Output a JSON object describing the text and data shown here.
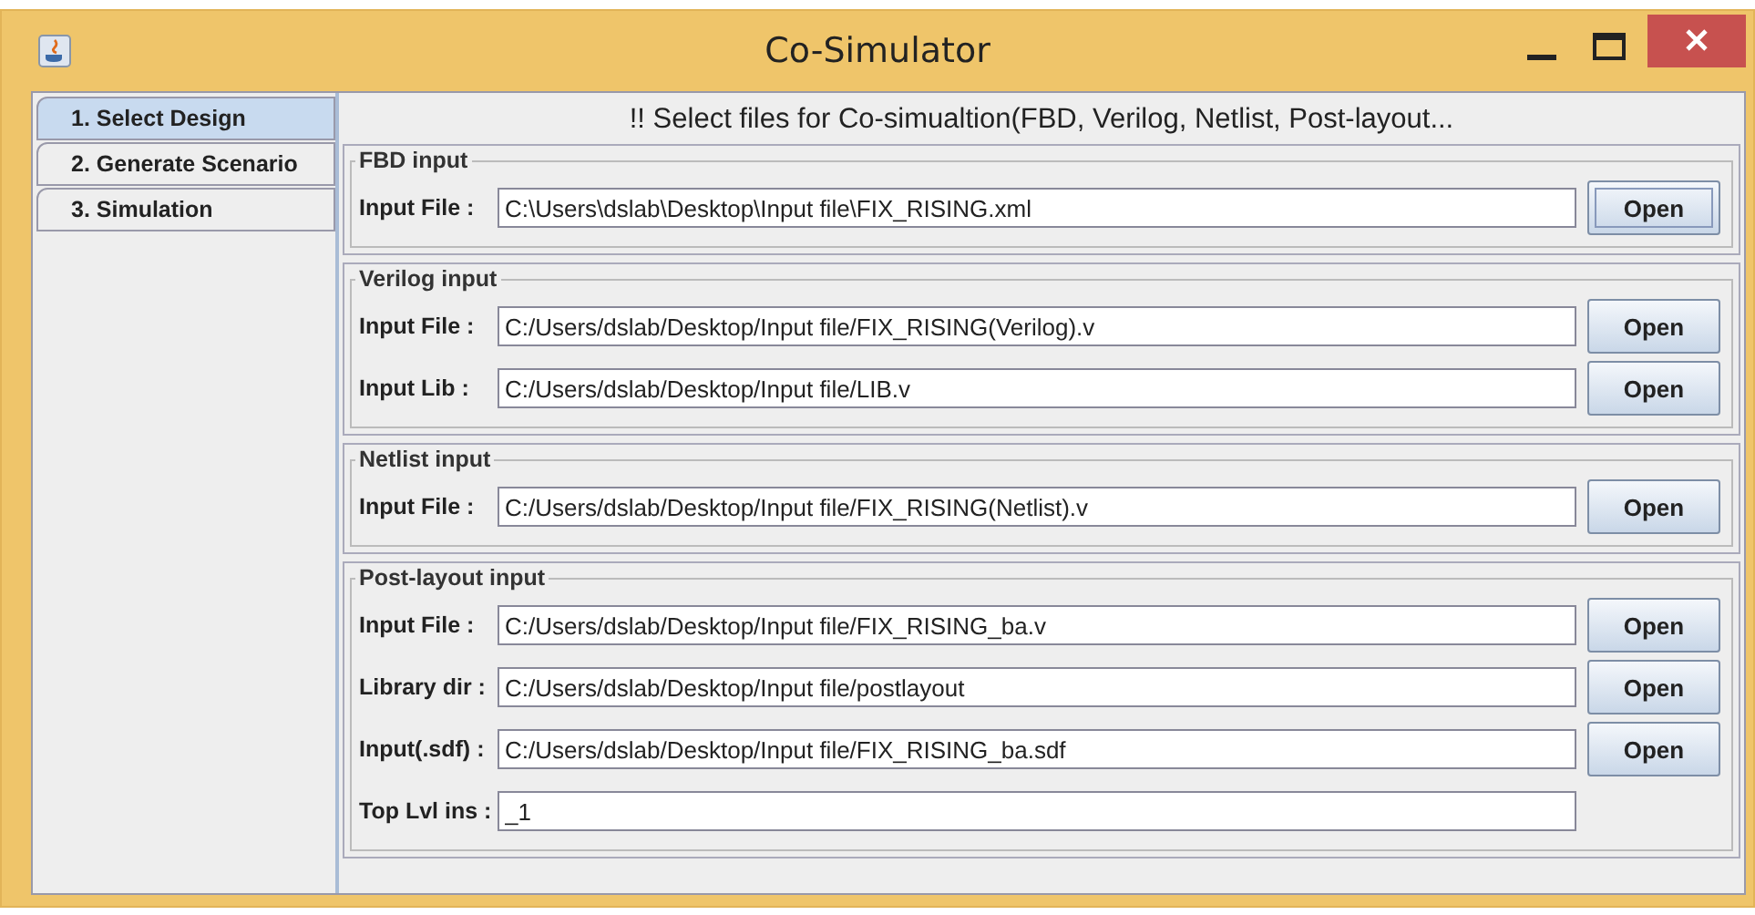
{
  "window": {
    "title": "Co-Simulator"
  },
  "tabs": [
    {
      "label": "1. Select Design",
      "selected": true
    },
    {
      "label": "2. Generate Scenario",
      "selected": false
    },
    {
      "label": "3. Simulation",
      "selected": false
    }
  ],
  "heading": "!! Select files for Co-simualtion(FBD, Verilog, Netlist, Post-layout...",
  "sections": [
    {
      "title": "FBD input",
      "rows": [
        {
          "label": "Input File :",
          "value": "C:\\Users\\dslab\\Desktop\\Input file\\FIX_RISING.xml",
          "button": {
            "label": "Open",
            "focused": true
          }
        }
      ]
    },
    {
      "title": "Verilog input",
      "rows": [
        {
          "label": "Input File :",
          "value": "C:/Users/dslab/Desktop/Input file/FIX_RISING(Verilog).v",
          "button": {
            "label": "Open",
            "focused": false
          }
        },
        {
          "label": "Input Lib  :",
          "value": "C:/Users/dslab/Desktop/Input file/LIB.v",
          "button": {
            "label": "Open",
            "focused": false
          }
        }
      ]
    },
    {
      "title": "Netlist input",
      "rows": [
        {
          "label": "Input File :",
          "value": "C:/Users/dslab/Desktop/Input file/FIX_RISING(Netlist).v",
          "button": {
            "label": "Open",
            "focused": false
          }
        }
      ]
    },
    {
      "title": "Post-layout input",
      "rows": [
        {
          "label": "Input File :",
          "value": "C:/Users/dslab/Desktop/Input file/FIX_RISING_ba.v",
          "button": {
            "label": "Open",
            "focused": false
          }
        },
        {
          "label": "Library dir :",
          "value": "C:/Users/dslab/Desktop/Input file/postlayout",
          "button": {
            "label": "Open",
            "focused": false
          }
        },
        {
          "label": "Input(.sdf) :",
          "value": "C:/Users/dslab/Desktop/Input file/FIX_RISING_ba.sdf",
          "button": {
            "label": "Open",
            "focused": false
          }
        },
        {
          "label": "Top Lvl ins :",
          "value": "_1"
        }
      ]
    }
  ]
}
